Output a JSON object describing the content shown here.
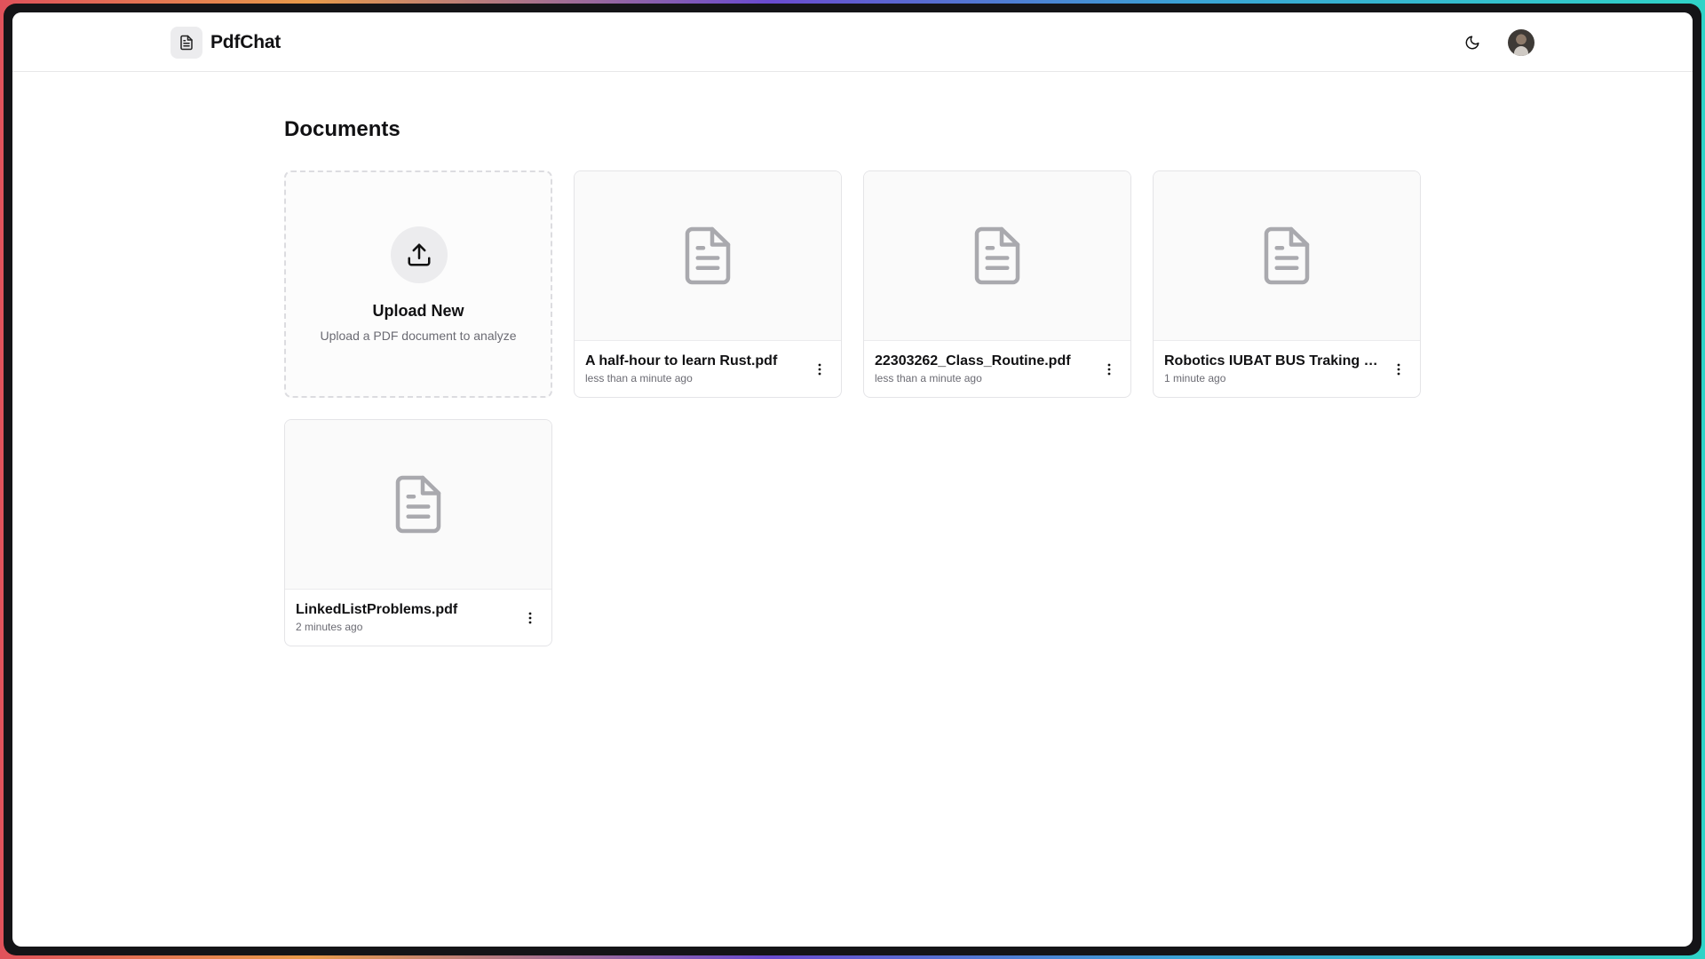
{
  "app": {
    "name": "PdfChat",
    "logo_icon": "file-text-icon",
    "theme_icon": "moon-icon",
    "avatar": "user-avatar"
  },
  "main": {
    "title": "Documents",
    "upload": {
      "title": "Upload New",
      "subtitle": "Upload a PDF document to analyze",
      "icon": "upload-icon"
    },
    "documents": [
      {
        "name": "A half-hour to learn Rust.pdf",
        "time": "less than a minute ago"
      },
      {
        "name": "22303262_Class_Routine.pdf",
        "time": "less than a minute ago"
      },
      {
        "name": "Robotics IUBAT BUS Traking System.pdf",
        "time": "1 minute ago"
      },
      {
        "name": "LinkedListProblems.pdf",
        "time": "2 minutes ago"
      }
    ]
  },
  "colors": {
    "accent": "#111113",
    "muted_text": "#6b6b73",
    "icon_gray": "#a9a9ae",
    "border": "#e4e4e7"
  }
}
